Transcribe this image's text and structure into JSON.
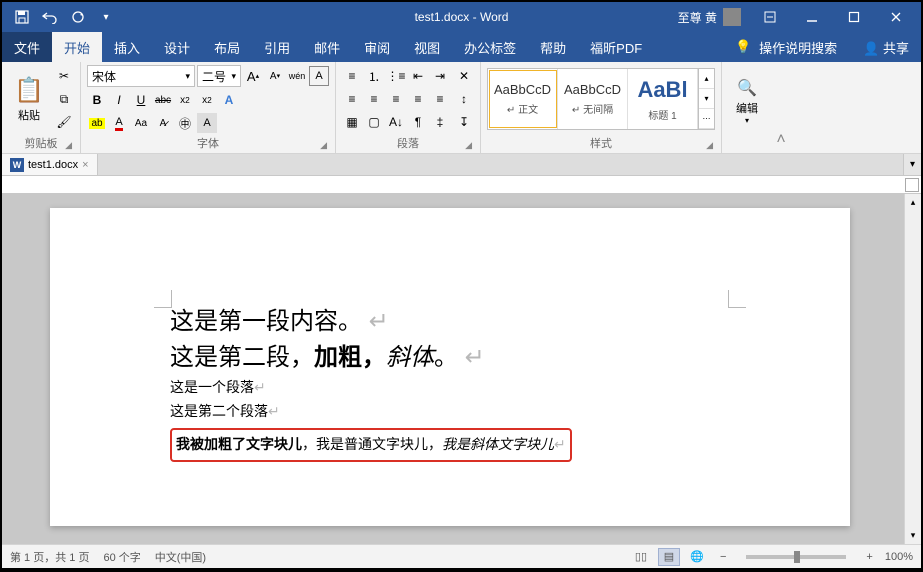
{
  "title": {
    "filename": "test1.docx",
    "app": "Word",
    "full": "test1.docx - Word"
  },
  "user": {
    "name": "至尊 黄"
  },
  "qat": {
    "save": "保存",
    "undo": "撤销",
    "redo": "重做"
  },
  "menu": {
    "file": "文件",
    "home": "开始",
    "insert": "插入",
    "design": "设计",
    "layout": "布局",
    "references": "引用",
    "mailings": "邮件",
    "review": "审阅",
    "view": "视图",
    "office": "办公标签",
    "help": "帮助",
    "foxit": "福昕PDF",
    "tellme": "操作说明搜索",
    "share": "共享"
  },
  "ribbon": {
    "clipboard": {
      "label": "剪贴板",
      "paste": "粘贴"
    },
    "font": {
      "label": "字体",
      "name": "宋体",
      "size": "二号",
      "btns": {
        "bold": "B",
        "italic": "I",
        "underline": "U",
        "strike": "abc",
        "sub": "x₂",
        "sup": "x²",
        "grow": "A",
        "shrink": "A",
        "clear": "清除格式",
        "phonetic": "wén",
        "border": "A",
        "highlight": "ab",
        "color": "A",
        "case": "Aa",
        "circled": "㊥"
      }
    },
    "paragraph": {
      "label": "段落"
    },
    "styles": {
      "label": "样式",
      "items": [
        {
          "preview": "AaBbCcD",
          "name": "↵ 正文"
        },
        {
          "preview": "AaBbCcD",
          "name": "↵ 无间隔"
        },
        {
          "preview": "AaBl",
          "name": "标题 1"
        }
      ]
    },
    "editing": {
      "label": "编辑"
    }
  },
  "docTab": {
    "name": "test1.docx"
  },
  "document": {
    "line1": "这是第一段内容。",
    "line2_a": "这是第二段，",
    "line2_b": "加粗，",
    "line2_c": "斜体",
    "line2_d": "。",
    "line3": "这是一个段落",
    "line4": "这是第二个段落",
    "line5_a": "我被加粗了文字块儿",
    "line5_b": "，我是普通文字块儿，",
    "line5_c": "我是斜体文字块儿"
  },
  "status": {
    "page": "第 1 页，共 1 页",
    "words": "60 个字",
    "lang": "中文(中国)",
    "zoom": "100%"
  }
}
